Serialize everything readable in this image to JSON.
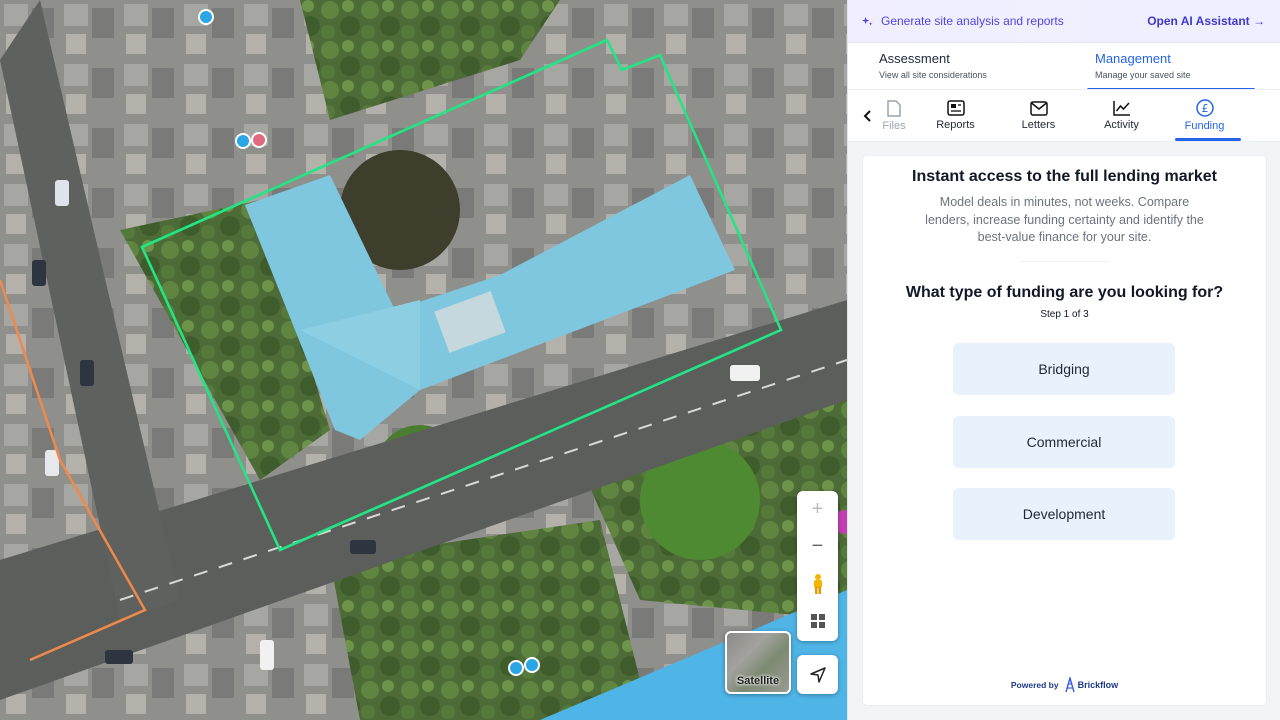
{
  "map": {
    "satellite_label": "Satellite",
    "controls": [
      "zoom-in",
      "zoom-out",
      "street-view",
      "layers"
    ],
    "site_outline_color": "#22e584",
    "boundary_color": "#f08a4b"
  },
  "ai_bar": {
    "prompt": "Generate site analysis and reports",
    "action": "Open AI Assistant →"
  },
  "mode_tabs": [
    {
      "title": "Assessment",
      "subtitle": "View all site considerations",
      "active": false
    },
    {
      "title": "Management",
      "subtitle": "Manage your saved site",
      "active": true
    }
  ],
  "tool_tabs": [
    {
      "label": "Files",
      "icon": "file-icon"
    },
    {
      "label": "Reports",
      "icon": "newspaper-icon"
    },
    {
      "label": "Letters",
      "icon": "mail-icon"
    },
    {
      "label": "Activity",
      "icon": "chart-line-icon"
    },
    {
      "label": "Funding",
      "icon": "pound-icon",
      "active": true
    }
  ],
  "funding": {
    "headline": "Instant access to the full lending market",
    "lead": "Model deals in minutes, not weeks. Compare lenders, increase funding certainty and identify the best-value finance for your site.",
    "question": "What type of funding are you looking for?",
    "step": "Step 1 of 3",
    "options": [
      "Bridging",
      "Commercial",
      "Development"
    ],
    "powered_by": "Powered by",
    "brand": "Brickflow"
  },
  "colors": {
    "accent": "#2563eb",
    "ai": "#4f46e5",
    "option_bg": "#e8f2fd"
  }
}
